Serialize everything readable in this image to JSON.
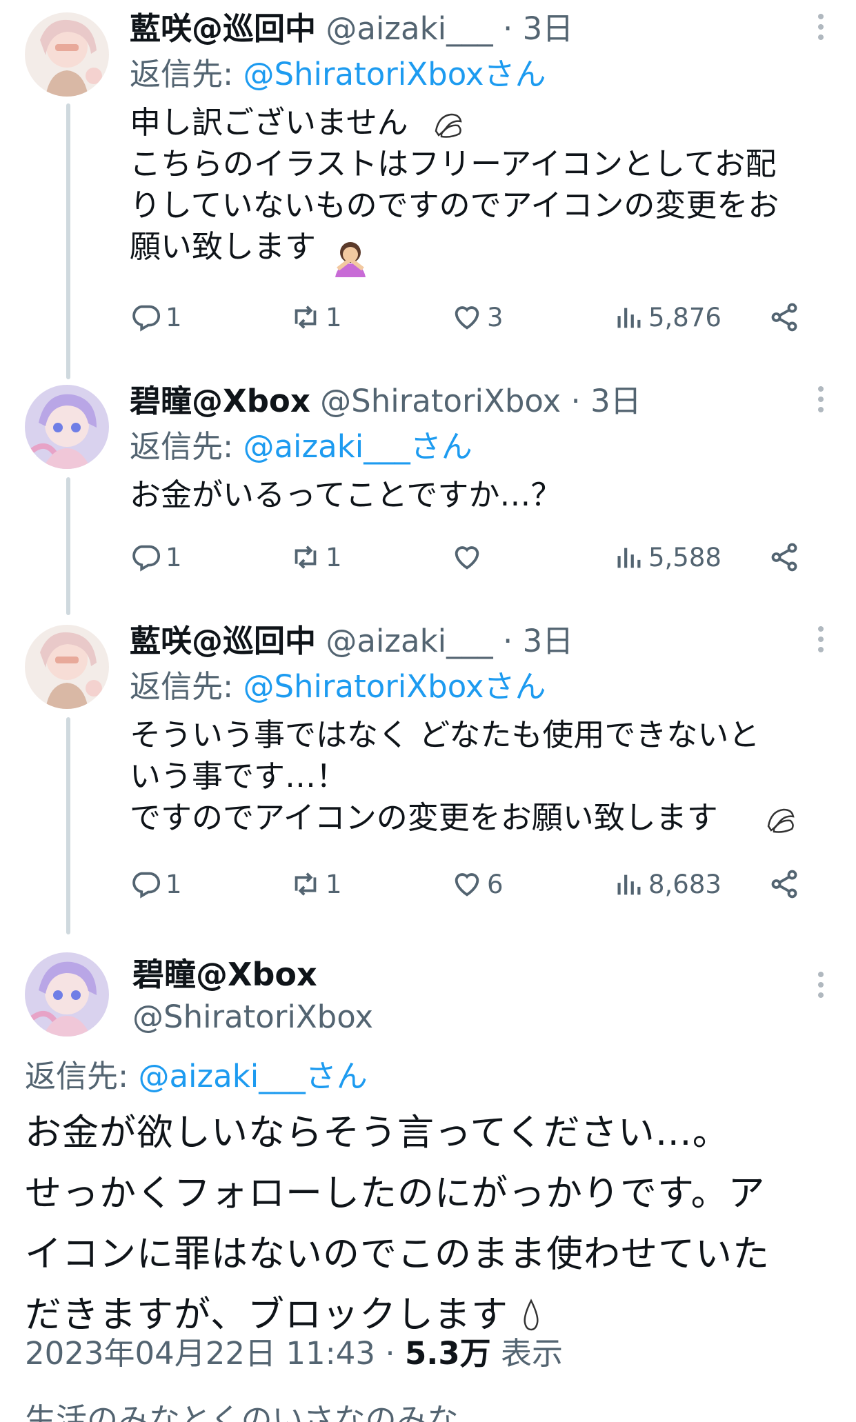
{
  "tweets": [
    {
      "name": "藍咲@巡回中",
      "handle": "@aizaki___",
      "sep": "·",
      "time": "3日",
      "reply_prefix": "返信先: ",
      "reply_to": "@ShiratoriXboxさん",
      "text": "申し訳ございません\nこちらのイラストはフリーアイコンとしてお配\nりしていないものですのでアイコンの変更をお\n願い致します",
      "replies": "1",
      "retweets": "1",
      "likes": "3",
      "views": "5,876"
    },
    {
      "name": "碧瞳@Xbox",
      "handle": "@ShiratoriXbox",
      "sep": "·",
      "time": "3日",
      "reply_prefix": "返信先: ",
      "reply_to": "@aizaki___さん",
      "text": "お金がいるってことですか…？",
      "replies": "1",
      "retweets": "1",
      "likes": "",
      "views": "5,588"
    },
    {
      "name": "藍咲@巡回中",
      "handle": "@aizaki___",
      "sep": "·",
      "time": "3日",
      "reply_prefix": "返信先: ",
      "reply_to": "@ShiratoriXboxさん",
      "text": "そういう事ではなく どなたも使用できないと\nいう事です…！\nですのでアイコンの変更をお願い致します",
      "replies": "1",
      "retweets": "1",
      "likes": "6",
      "views": "8,683"
    }
  ],
  "focal": {
    "name": "碧瞳@Xbox",
    "handle": "@ShiratoriXbox",
    "reply_prefix": "返信先: ",
    "reply_to": "@aizaki___さん",
    "line1": "お金が欲しいならそう言ってください…。",
    "line2": "せっかくフォローしたのにがっかりです。ア",
    "line3": "イコンに罪はないのでこのまま使わせていた",
    "line4": "だきますが、ブロックします",
    "date": "2023年04月22日 11:43",
    "sep": " · ",
    "views_count": "5.3万",
    "views_label": " 表示",
    "cut_text": "生活のみなとくのいさなのみな"
  },
  "icons": {
    "reply": "reply-icon",
    "retweet": "retweet-icon",
    "like": "heart-icon",
    "views": "views-icon",
    "share": "share-icon",
    "more": "more-icon",
    "emoji_pray": "bowing-hands-emoji",
    "emoji_person": "person-gesturing-emoji",
    "emoji_drop": "droplet-emoji"
  }
}
